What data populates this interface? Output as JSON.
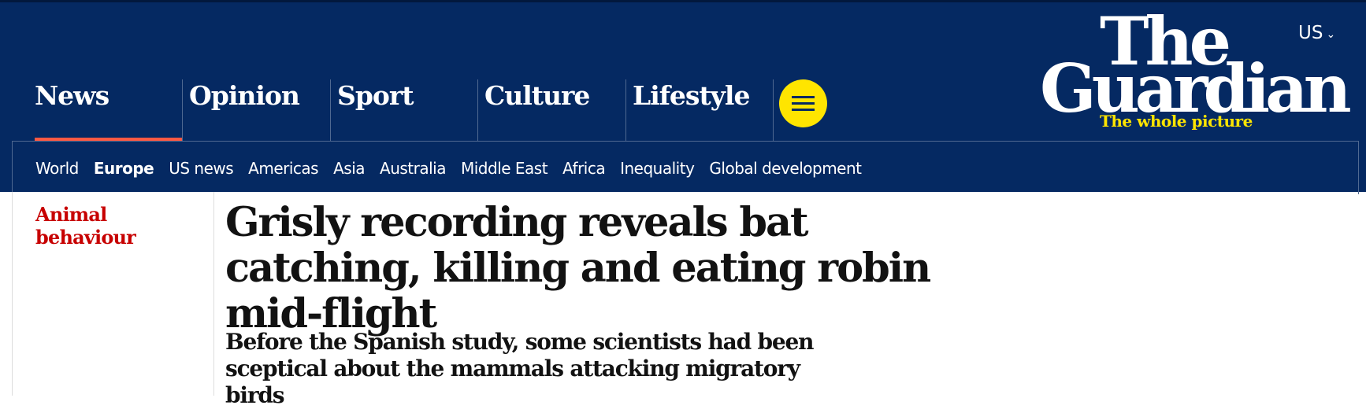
{
  "header": {
    "edition_label": "US",
    "logo": {
      "line1": "The",
      "line2": "Guardian",
      "tagline": "The whole picture"
    },
    "pillars": [
      {
        "label": "News",
        "active": true
      },
      {
        "label": "Opinion",
        "active": false
      },
      {
        "label": "Sport",
        "active": false
      },
      {
        "label": "Culture",
        "active": false
      },
      {
        "label": "Lifestyle",
        "active": false
      }
    ],
    "subnav": [
      {
        "label": "World",
        "active": false
      },
      {
        "label": "Europe",
        "active": true
      },
      {
        "label": "US news",
        "active": false
      },
      {
        "label": "Americas",
        "active": false
      },
      {
        "label": "Asia",
        "active": false
      },
      {
        "label": "Australia",
        "active": false
      },
      {
        "label": "Middle East",
        "active": false
      },
      {
        "label": "Africa",
        "active": false
      },
      {
        "label": "Inequality",
        "active": false
      },
      {
        "label": "Global development",
        "active": false
      }
    ]
  },
  "article": {
    "section": "Animal behaviour",
    "headline": "Grisly recording reveals bat catching, killing and eating robin mid-flight",
    "standfirst": "Before the Spanish study, some scientists had been sceptical about the mammals attacking migratory birds"
  },
  "colors": {
    "brand_blue": "#052962",
    "news_accent": "#ff5943",
    "menu_yellow": "#ffe500",
    "kicker_red": "#c70000"
  },
  "icons": {
    "menu": "hamburger-menu-icon",
    "edition_toggle": "chevron-down-icon"
  }
}
